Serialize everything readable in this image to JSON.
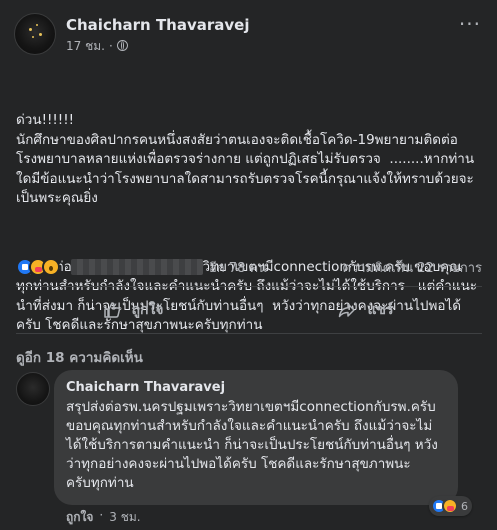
{
  "post": {
    "author": "Chaicharn Thavaravej",
    "time": "17 ชม.",
    "separator": "·",
    "body_para1": "ด่วน!!!!!!\nนักศึกษาของศิลปากรคนหนึ่งสงสัยว่าตนเองจะติดเชื้อโควิด-19พยายามติดต่อ\nโรงพยาบาลหลายแห่งเพื่อตรวจร่างกาย แต่ถูกปฏิเสธไม่รับตรวจ  ........หากท่าน\nใดมีข้อแนะนำว่าโรงพยาบาลใดสามารถรับตรวจโรคนี้กรุณาแจ้งให้ทราบด้วยจะ\nเป็นพระคุณยิ่ง",
    "body_para2": "สรุปส่งต่อรพ.นครปฐมด้วยเพราะวิทยาเขตฯมีconnectionกับรพ.ครับ ขอบคุณ\nทุกท่านสำหรับกำลังใจและคำแนะนำครับ ถึงแม้ว่าจะไม่ได้ใช้บริการ   แต่คำแนะ\nนำที่ส่งมา ก็น่าจะเป็นประโยชน์กับท่านอื่นๆ  หวังว่าทุกอย่างคงจะผ่านไปพอได้\nครับ โชคดีและรักษาสุขภาพนะครับทุกท่าน"
  },
  "stats": {
    "reactions": [
      "like",
      "care",
      "wow"
    ],
    "others": "อีก 78 คน",
    "comments": "ความคิดเห็น 22 รายการ"
  },
  "actions": {
    "like_label": "ถูกใจ",
    "share_label": "แชร์"
  },
  "view_more": "ดูอีก 18 ความคิดเห็น",
  "comment": {
    "author": "Chaicharn Thavaravej",
    "text": "สรุปส่งต่อรพ.นครปฐมเพราะวิทยาเขตฯมีconnectionกับรพ.ครับ\nขอบคุณทุกท่านสำหรับกำลังใจและคำแนะนำครับ ถึงแม้ว่าจะไม่\nได้ใช้บริการตามคำแนะนำ ก็น่าจะเป็นประโยชน์กับท่านอื่นๆ หวัง\nว่าทุกอย่างคงจะผ่านไปพอได้ครับ โชคดีและรักษาสุขภาพนะ\nครับทุกท่าน",
    "reaction_count": "6",
    "like_label": "ถูกใจ",
    "separator": "·",
    "time": "3 ชม."
  },
  "colors": {
    "background": "#242526",
    "bubble": "#3a3b3c",
    "primary_text": "#e4e6eb",
    "secondary_text": "#b0b3b8",
    "like_blue": "#2078f4",
    "reaction_yellow": "#f7b125"
  }
}
